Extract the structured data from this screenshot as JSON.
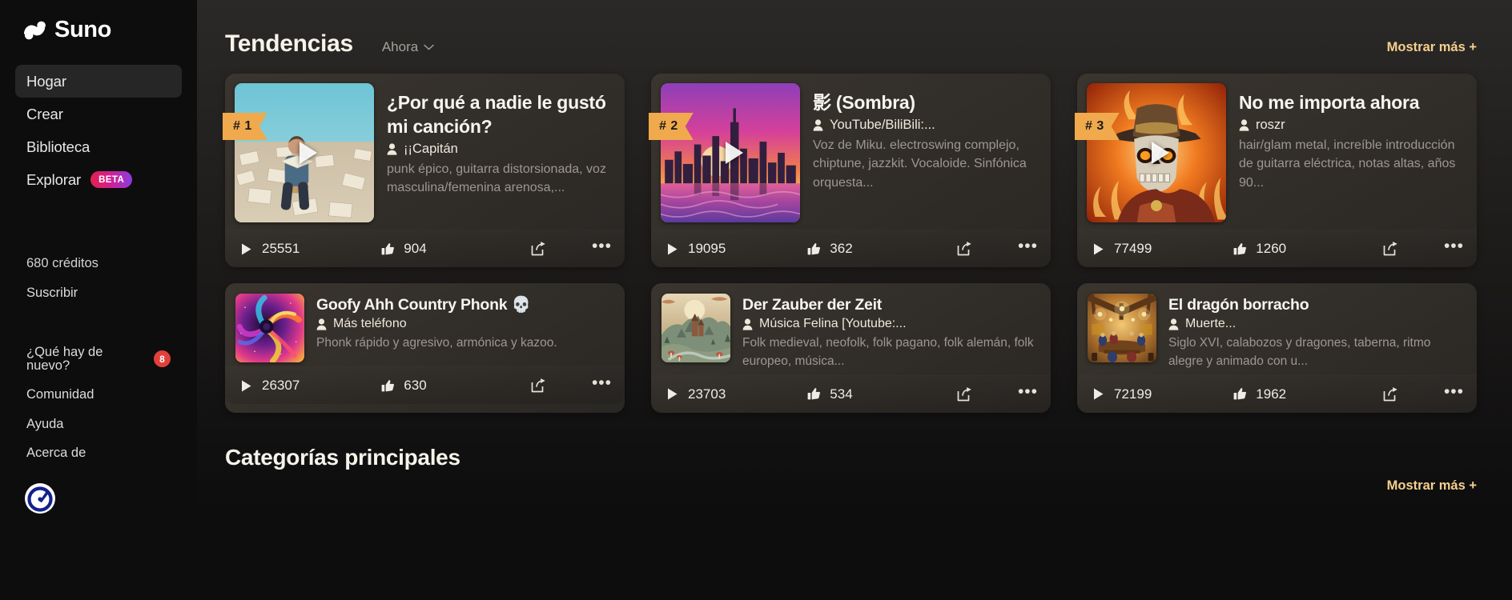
{
  "sidebar": {
    "brand": "Suno",
    "brand_icon": "suno-logo-icon",
    "nav": [
      {
        "label": "Hogar",
        "active": true
      },
      {
        "label": "Crear",
        "active": false
      },
      {
        "label": "Biblioteca",
        "active": false
      },
      {
        "label": "Explorar",
        "active": false,
        "badge": "BETA"
      }
    ],
    "credits": "680 créditos",
    "subscribe": "Suscribir",
    "secondary": [
      {
        "label": "¿Qué hay de nuevo?",
        "count": "8"
      },
      {
        "label": "Comunidad"
      },
      {
        "label": "Ayuda"
      },
      {
        "label": "Acerca de"
      }
    ],
    "footer_icon": "circular-app-badge-icon"
  },
  "trending": {
    "title": "Tendencias",
    "filter": "Ahora",
    "filter_icon": "chevron-down-icon",
    "show_more": "Mostrar más +",
    "featured": [
      {
        "rank": "# 1",
        "title": "¿Por qué a nadie le gustó mi canción?",
        "artist": "¡¡Capitán",
        "tags": "punk épico, guitarra distorsionada, voz masculina/femenina arenosa,...",
        "plays": "25551",
        "likes": "904",
        "art": "man-reading-book-on-sheet-music-field"
      },
      {
        "rank": "# 2",
        "title": "影 (Sombra)",
        "artist": "YouTube/BiliBili:...",
        "tags": "Voz de Miku. electroswing complejo, chiptune, jazzkit. Vocaloide. Sinfónica orquesta...",
        "plays": "19095",
        "likes": "362",
        "art": "purple-sunset-city-skyline"
      },
      {
        "rank": "# 3",
        "title": "No me importa ahora",
        "artist": "roszr",
        "tags": "hair/glam metal, increíble introducción de guitarra eléctrica, notas altas, años 90...",
        "plays": "77499",
        "likes": "1260",
        "art": "flaming-skull-cowboy"
      }
    ],
    "secondary": [
      {
        "title": "Goofy Ahh Country Phonk 💀",
        "artist": "Más teléfono",
        "tags": "Phonk rápido y agresivo, armónica y kazoo.",
        "plays": "26307",
        "likes": "630",
        "art": "colorful-swirl-nebula"
      },
      {
        "title": "Der Zauber der Zeit",
        "artist": "Música Felina [Youtube:...",
        "tags": "Folk medieval, neofolk, folk pagano, folk alemán, folk europeo, música...",
        "plays": "23703",
        "likes": "534",
        "art": "medieval-fantasy-village-illustration"
      },
      {
        "title": "El dragón borracho",
        "artist": "Muerte...",
        "tags": "Siglo XVI, calabozos y dragones, taberna, ritmo alegre y animado con u...",
        "plays": "72199",
        "likes": "1962",
        "art": "tavern-interior-illustration"
      }
    ],
    "icons": {
      "play": "play-icon",
      "like": "thumbs-up-icon",
      "share": "share-icon",
      "more": "more-options-icon",
      "person": "person-icon"
    }
  },
  "categories": {
    "title": "Categorías principales",
    "show_more": "Mostrar más +"
  },
  "colors": {
    "accent": "#f5cf8f",
    "rank_badge": "#f0aa4d",
    "notification": "#e2403a",
    "beta_from": "#e0214f",
    "beta_to": "#8b3ce0"
  }
}
